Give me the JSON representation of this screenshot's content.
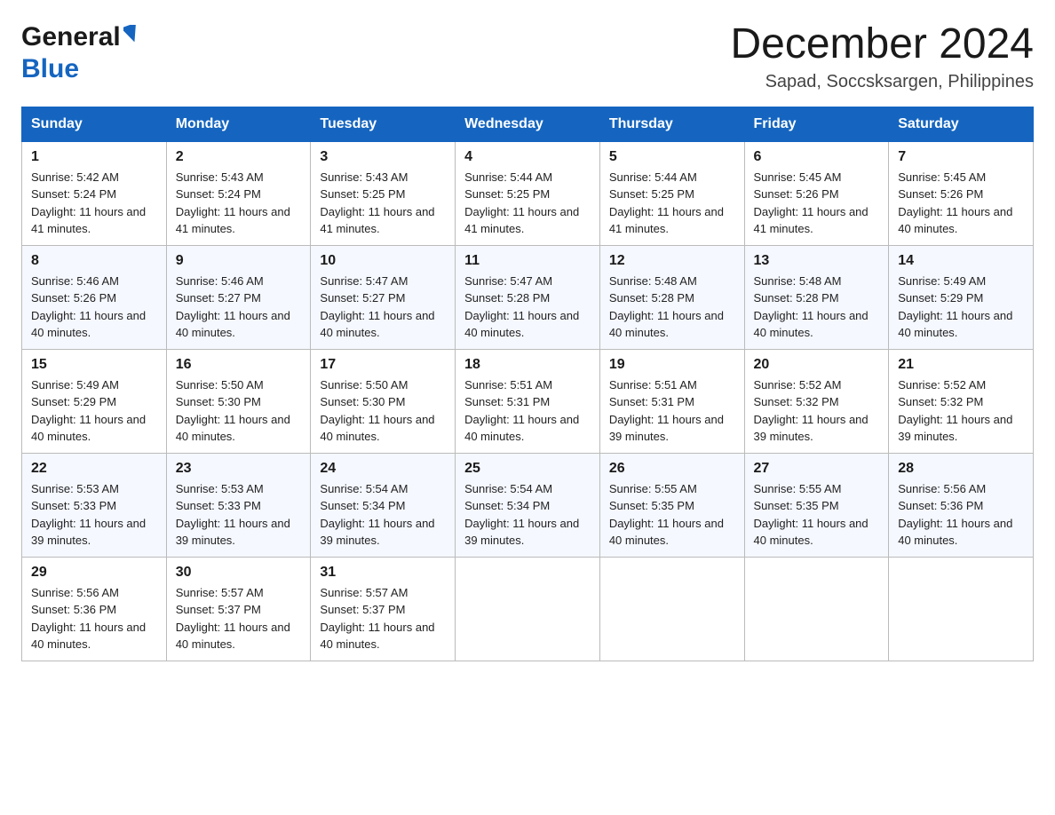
{
  "header": {
    "logo_general": "General",
    "logo_blue": "Blue",
    "month_title": "December 2024",
    "location": "Sapad, Soccsksargen, Philippines"
  },
  "weekdays": [
    "Sunday",
    "Monday",
    "Tuesday",
    "Wednesday",
    "Thursday",
    "Friday",
    "Saturday"
  ],
  "weeks": [
    [
      {
        "day": "1",
        "sunrise": "5:42 AM",
        "sunset": "5:24 PM",
        "daylight": "11 hours and 41 minutes."
      },
      {
        "day": "2",
        "sunrise": "5:43 AM",
        "sunset": "5:24 PM",
        "daylight": "11 hours and 41 minutes."
      },
      {
        "day": "3",
        "sunrise": "5:43 AM",
        "sunset": "5:25 PM",
        "daylight": "11 hours and 41 minutes."
      },
      {
        "day": "4",
        "sunrise": "5:44 AM",
        "sunset": "5:25 PM",
        "daylight": "11 hours and 41 minutes."
      },
      {
        "day": "5",
        "sunrise": "5:44 AM",
        "sunset": "5:25 PM",
        "daylight": "11 hours and 41 minutes."
      },
      {
        "day": "6",
        "sunrise": "5:45 AM",
        "sunset": "5:26 PM",
        "daylight": "11 hours and 41 minutes."
      },
      {
        "day": "7",
        "sunrise": "5:45 AM",
        "sunset": "5:26 PM",
        "daylight": "11 hours and 40 minutes."
      }
    ],
    [
      {
        "day": "8",
        "sunrise": "5:46 AM",
        "sunset": "5:26 PM",
        "daylight": "11 hours and 40 minutes."
      },
      {
        "day": "9",
        "sunrise": "5:46 AM",
        "sunset": "5:27 PM",
        "daylight": "11 hours and 40 minutes."
      },
      {
        "day": "10",
        "sunrise": "5:47 AM",
        "sunset": "5:27 PM",
        "daylight": "11 hours and 40 minutes."
      },
      {
        "day": "11",
        "sunrise": "5:47 AM",
        "sunset": "5:28 PM",
        "daylight": "11 hours and 40 minutes."
      },
      {
        "day": "12",
        "sunrise": "5:48 AM",
        "sunset": "5:28 PM",
        "daylight": "11 hours and 40 minutes."
      },
      {
        "day": "13",
        "sunrise": "5:48 AM",
        "sunset": "5:28 PM",
        "daylight": "11 hours and 40 minutes."
      },
      {
        "day": "14",
        "sunrise": "5:49 AM",
        "sunset": "5:29 PM",
        "daylight": "11 hours and 40 minutes."
      }
    ],
    [
      {
        "day": "15",
        "sunrise": "5:49 AM",
        "sunset": "5:29 PM",
        "daylight": "11 hours and 40 minutes."
      },
      {
        "day": "16",
        "sunrise": "5:50 AM",
        "sunset": "5:30 PM",
        "daylight": "11 hours and 40 minutes."
      },
      {
        "day": "17",
        "sunrise": "5:50 AM",
        "sunset": "5:30 PM",
        "daylight": "11 hours and 40 minutes."
      },
      {
        "day": "18",
        "sunrise": "5:51 AM",
        "sunset": "5:31 PM",
        "daylight": "11 hours and 40 minutes."
      },
      {
        "day": "19",
        "sunrise": "5:51 AM",
        "sunset": "5:31 PM",
        "daylight": "11 hours and 39 minutes."
      },
      {
        "day": "20",
        "sunrise": "5:52 AM",
        "sunset": "5:32 PM",
        "daylight": "11 hours and 39 minutes."
      },
      {
        "day": "21",
        "sunrise": "5:52 AM",
        "sunset": "5:32 PM",
        "daylight": "11 hours and 39 minutes."
      }
    ],
    [
      {
        "day": "22",
        "sunrise": "5:53 AM",
        "sunset": "5:33 PM",
        "daylight": "11 hours and 39 minutes."
      },
      {
        "day": "23",
        "sunrise": "5:53 AM",
        "sunset": "5:33 PM",
        "daylight": "11 hours and 39 minutes."
      },
      {
        "day": "24",
        "sunrise": "5:54 AM",
        "sunset": "5:34 PM",
        "daylight": "11 hours and 39 minutes."
      },
      {
        "day": "25",
        "sunrise": "5:54 AM",
        "sunset": "5:34 PM",
        "daylight": "11 hours and 39 minutes."
      },
      {
        "day": "26",
        "sunrise": "5:55 AM",
        "sunset": "5:35 PM",
        "daylight": "11 hours and 40 minutes."
      },
      {
        "day": "27",
        "sunrise": "5:55 AM",
        "sunset": "5:35 PM",
        "daylight": "11 hours and 40 minutes."
      },
      {
        "day": "28",
        "sunrise": "5:56 AM",
        "sunset": "5:36 PM",
        "daylight": "11 hours and 40 minutes."
      }
    ],
    [
      {
        "day": "29",
        "sunrise": "5:56 AM",
        "sunset": "5:36 PM",
        "daylight": "11 hours and 40 minutes."
      },
      {
        "day": "30",
        "sunrise": "5:57 AM",
        "sunset": "5:37 PM",
        "daylight": "11 hours and 40 minutes."
      },
      {
        "day": "31",
        "sunrise": "5:57 AM",
        "sunset": "5:37 PM",
        "daylight": "11 hours and 40 minutes."
      },
      null,
      null,
      null,
      null
    ]
  ],
  "labels": {
    "sunrise": "Sunrise:",
    "sunset": "Sunset:",
    "daylight": "Daylight:"
  }
}
